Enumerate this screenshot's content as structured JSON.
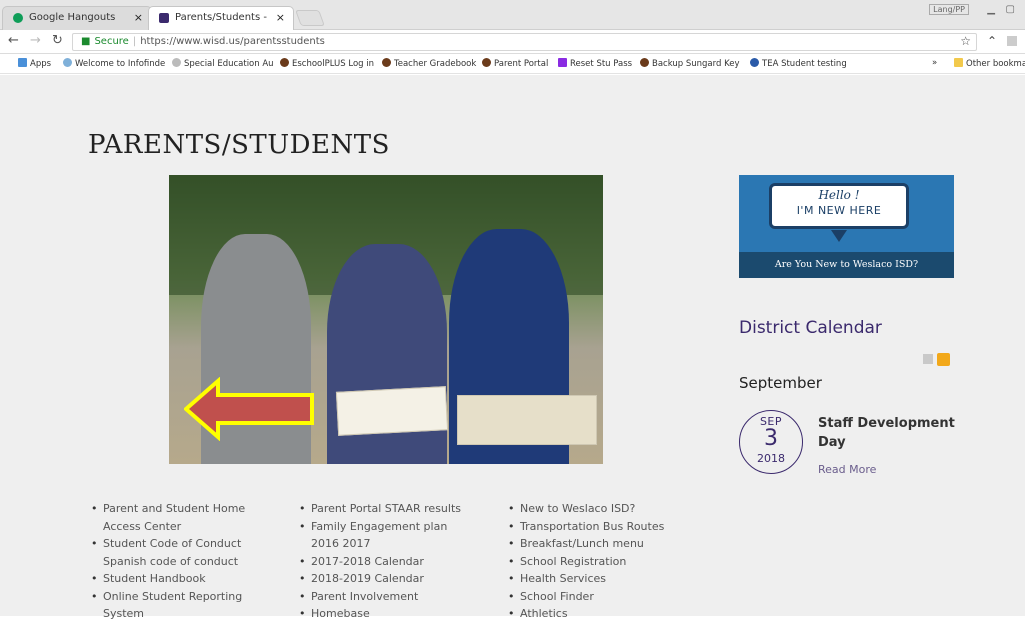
{
  "browser": {
    "tabs": [
      {
        "label": "Google Hangouts",
        "close": "×"
      },
      {
        "label": "Parents/Students - Wesla",
        "close": "×"
      }
    ],
    "window_label": "Lang/PP",
    "url_secure": "Secure",
    "url": "https://www.wisd.us/parentsstudents",
    "bookmarks": [
      "Apps",
      "Welcome to Infofinde",
      "Special Education Au",
      "EschoolPLUS Log in",
      "Teacher Gradebook",
      "Parent Portal",
      "Reset Stu Pass",
      "Backup Sungard Key",
      "TEA Student testing",
      "»",
      "Other bookma"
    ],
    "colors": {
      "secure": "#1b8a2e"
    }
  },
  "page": {
    "title": "PARENTS/STUDENTS",
    "promo": {
      "hello": "Hello !",
      "new": "I'M NEW HERE",
      "footer": "Are You New to Weslaco ISD?"
    },
    "calendar": {
      "heading": "District Calendar",
      "month": "September",
      "event": {
        "month": "SEP",
        "day": "3",
        "year": "2018",
        "title": "Staff Development Day",
        "read_more": "Read More"
      }
    },
    "links": {
      "col1": [
        "Parent and Student Home",
        "Access Center",
        "Student Code of Conduct",
        "Spanish code of conduct",
        "Student Handbook",
        "Online Student Reporting",
        "System"
      ],
      "col2": [
        "Parent Portal STAAR results",
        "Family Engagement plan",
        "2016 2017",
        "2017-2018 Calendar",
        "2018-2019 Calendar",
        "Parent Involvement",
        "Homebase"
      ],
      "col3": [
        "New to Weslaco ISD?",
        "Transportation Bus Routes",
        "Breakfast/Lunch menu",
        "School Registration",
        "Health Services",
        "School Finder",
        "Athletics"
      ]
    },
    "colors": {
      "brand_purple": "#3b2a6d",
      "promo_blue": "#2b77b3",
      "arrow_fill": "#c0504d",
      "arrow_border": "#ffff00"
    }
  }
}
